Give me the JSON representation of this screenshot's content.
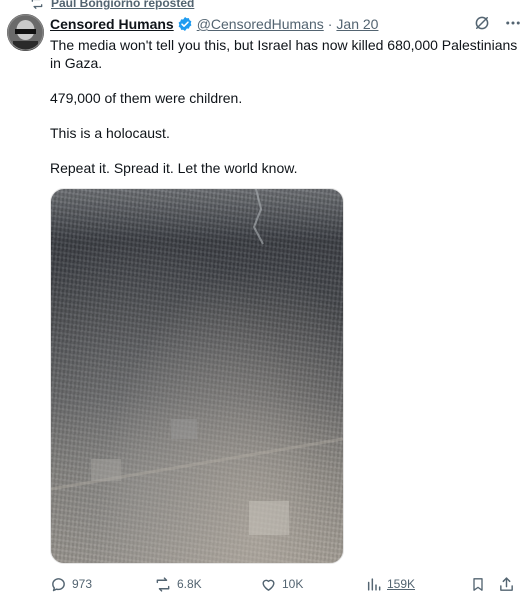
{
  "repost": {
    "text": "Paul Bongiorno reposted",
    "icon": "repost-icon"
  },
  "tweet": {
    "author_name": "Censored Humans",
    "handle": "@CensoredHumans",
    "separator": "·",
    "date": "Jan 20",
    "verified": true,
    "paragraphs": [
      "The media won't tell you this, but Israel has now killed 680,000 Palestinians in Gaza.",
      "479,000 of them were children.",
      "This is a holocaust.",
      "Repeat it. Spread it. Let the world know."
    ],
    "media_description": "aerial-photo"
  },
  "actions": {
    "replies": "973",
    "reposts": "6.8K",
    "likes": "10K",
    "views": "159K"
  },
  "colors": {
    "text": "#0f1419",
    "secondary": "#536471",
    "verified": "#1d9bf0"
  },
  "icons": [
    "repost-icon",
    "verified-badge-icon",
    "grok-icon",
    "more-icon",
    "reply-icon",
    "like-icon",
    "views-icon",
    "bookmark-icon",
    "share-icon"
  ]
}
